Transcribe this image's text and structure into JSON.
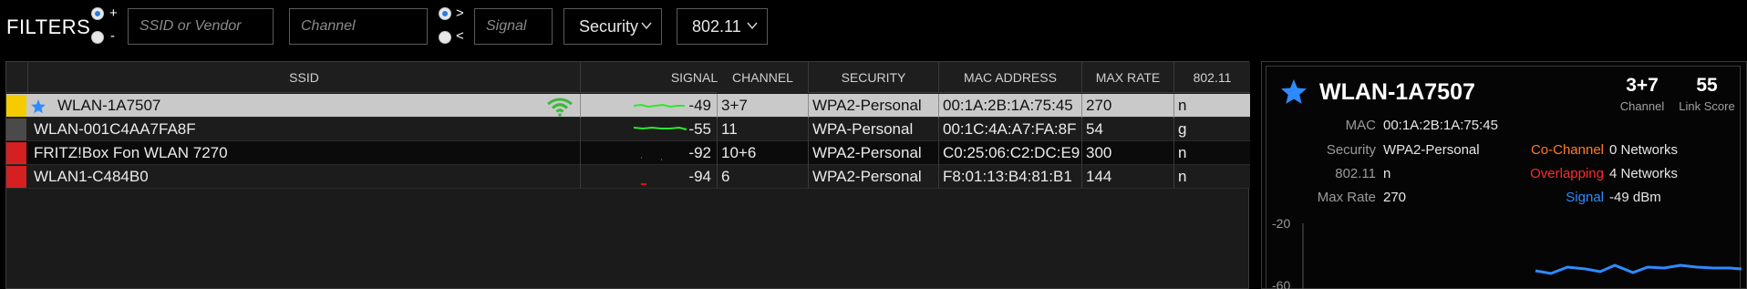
{
  "filters": {
    "title": "FILTERS",
    "plus_label": "+",
    "minus_label": "-",
    "ssid_placeholder": "SSID or Vendor",
    "channel_placeholder": "Channel",
    "gt_label": ">",
    "lt_label": "<",
    "signal_placeholder": "Signal",
    "security_label": "Security",
    "dot11_label": "802.11"
  },
  "table": {
    "headers": {
      "ssid": "SSID",
      "signal": "SIGNAL",
      "channel": "CHANNEL",
      "security": "SECURITY",
      "mac": "MAC ADDRESS",
      "max_rate": "MAX RATE",
      "dot11": "802.11"
    },
    "rows": [
      {
        "color": "#f5cc00",
        "ssid": "WLAN-1A7507",
        "signal": "-49",
        "channel": "3+7",
        "security": "WPA2-Personal",
        "mac": "00:1A:2B:1A:75:45",
        "max_rate": "270",
        "dot11": "n",
        "starred": true,
        "connected": true
      },
      {
        "color": "#4a4a4a",
        "ssid": "WLAN-001C4AA7FA8F",
        "signal": "-55",
        "channel": "11",
        "security": "WPA-Personal",
        "mac": "00:1C:4A:A7:FA:8F",
        "max_rate": "54",
        "dot11": "g"
      },
      {
        "color": "#d42020",
        "ssid": "FRITZ!Box Fon WLAN 7270",
        "signal": "-92",
        "channel": "10+6",
        "security": "WPA2-Personal",
        "mac": "C0:25:06:C2:DC:E9",
        "max_rate": "300",
        "dot11": "n"
      },
      {
        "color": "#d42020",
        "ssid": "WLAN1-C484B0",
        "signal": "-94",
        "channel": "6",
        "security": "WPA2-Personal",
        "mac": "F8:01:13:B4:81:B1",
        "max_rate": "144",
        "dot11": "n"
      }
    ]
  },
  "details": {
    "title": "WLAN-1A7507",
    "channel_value": "3+7",
    "channel_label": "Channel",
    "link_score_value": "55",
    "link_score_label": "Link Score",
    "mac_label": "MAC",
    "mac_value": "00:1A:2B:1A:75:45",
    "security_label": "Security",
    "security_value": "WPA2-Personal",
    "dot11_label": "802.11",
    "dot11_value": "n",
    "max_rate_label": "Max Rate",
    "max_rate_value": "270",
    "co_channel_label": "Co-Channel",
    "co_channel_value": "0 Networks",
    "overlapping_label": "Overlapping",
    "overlapping_value": "4 Networks",
    "signal_label": "Signal",
    "signal_value": "-49 dBm",
    "graph_y_top": "-20",
    "graph_y_next": "-60",
    "colors": {
      "co_channel": "#ff7a2a",
      "overlapping": "#ff2a2a",
      "signal": "#2e8bff"
    }
  },
  "icons": {
    "star": "star-icon",
    "wifi": "wifi-icon",
    "chevron": "chevron-down-icon",
    "sort": "sort-desc-icon"
  }
}
